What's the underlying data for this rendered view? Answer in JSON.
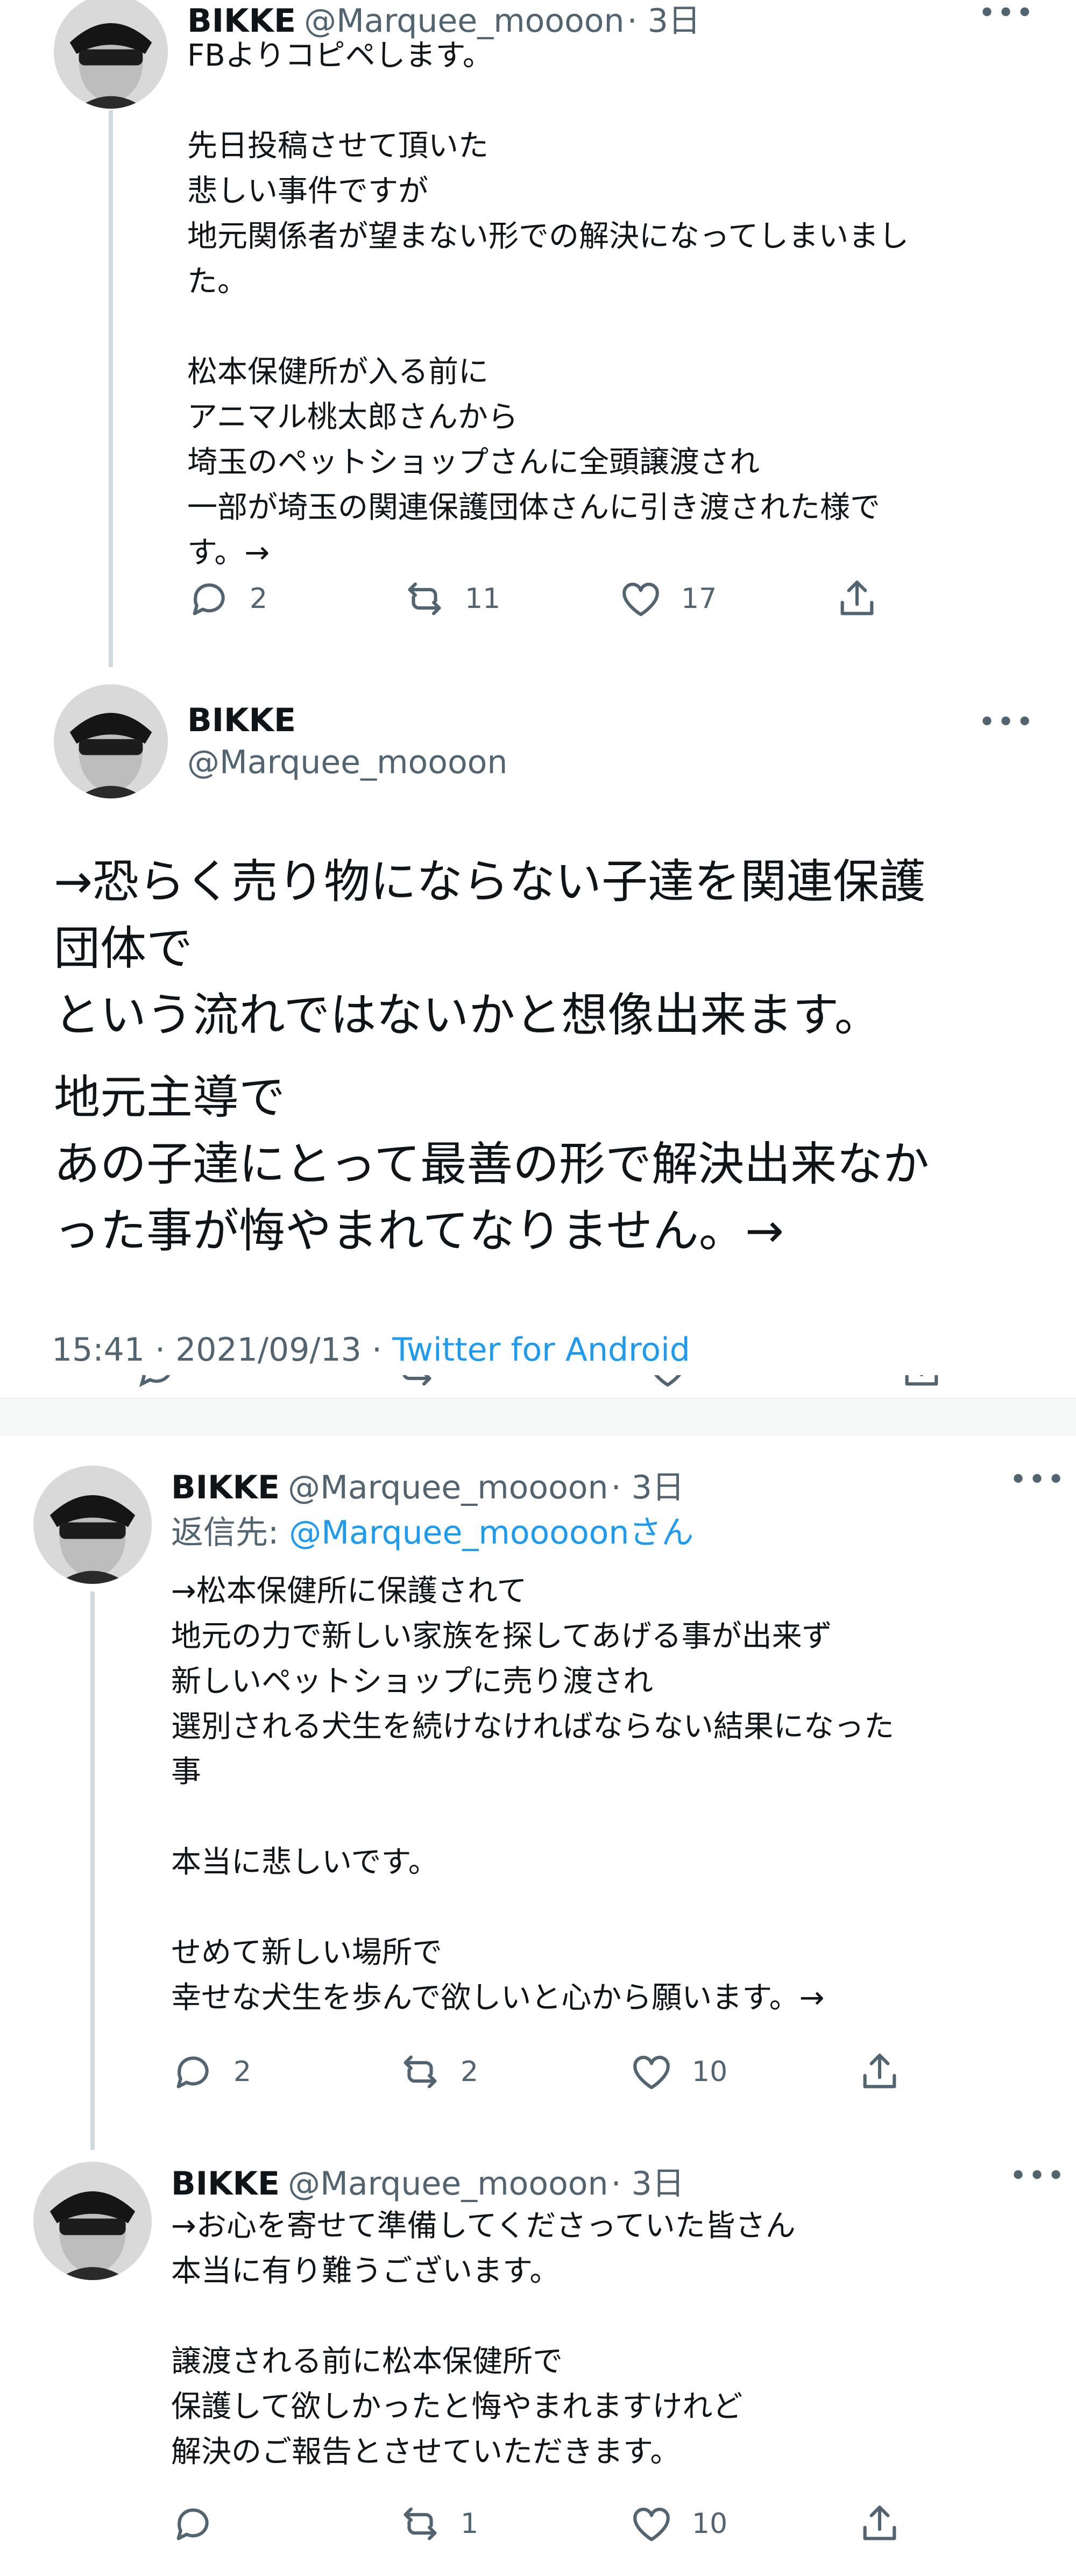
{
  "tweets": [
    {
      "name": "BIKKE",
      "handle": "@Marquee_moooon",
      "time": "· 3日",
      "text": "FBよりコピペします。\n\n先日投稿させて頂いた\n悲しい事件ですが\n地元関係者が望まない形での解決になってしまいまし\nた。\n\n松本保健所が入る前に\nアニマル桃太郎さんから\n埼玉のペットショップさんに全頭譲渡され\n一部が埼玉の関連保護団体さんに引き渡された様で\nす。→",
      "replies": "2",
      "retweets": "11",
      "likes": "17"
    },
    {
      "name": "BIKKE",
      "handle": "@Marquee_moooon",
      "text": "→恐らく売り物にならない子達を関連保護\n団体で\nという流れではないかと想像出来ます。",
      "text2": "地元主導で\nあの子達にとって最善の形で解決出来なか\nった事が悔やまれてなりません。→",
      "timestamp": "15:41 · 2021/09/13 · ",
      "source": "Twitter for Android"
    },
    {
      "name": "BIKKE",
      "handle": "@Marquee_moooon",
      "time": "· 3日",
      "reply_label": "返信先: ",
      "reply_handle": "@Marquee_mooooonさん",
      "text": "→松本保健所に保護されて\n地元の力で新しい家族を探してあげる事が出来ず\n新しいペットショップに売り渡され\n選別される犬生を続けなければならない結果になった\n事\n\n本当に悲しいです。\n\nせめて新しい場所で\n幸せな犬生を歩んで欲しいと心から願います。→",
      "replies": "2",
      "retweets": "2",
      "likes": "10"
    },
    {
      "name": "BIKKE",
      "handle": "@Marquee_moooon",
      "time": "· 3日",
      "text": "→お心を寄せて準備してくださっていた皆さん\n本当に有り難うございます。\n\n譲渡される前に松本保健所で\n保護して欲しかったと悔やまれますけれど\n解決のご報告とさせていただきます。",
      "replies": "",
      "retweets": "1",
      "likes": "10"
    }
  ],
  "more_glyph": "•••",
  "colors": {
    "accent": "#1d9bf0",
    "secondary": "#536471",
    "line": "#cfd9de"
  }
}
